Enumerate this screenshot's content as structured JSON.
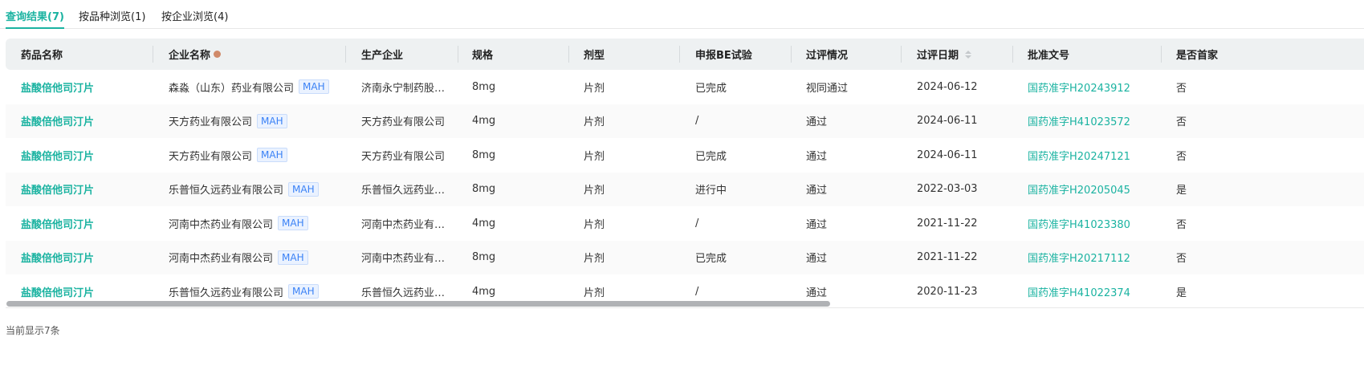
{
  "tabs": [
    {
      "label": "查询结果(7)",
      "active": true
    },
    {
      "label": "按品种浏览(1)"
    },
    {
      "label": "按企业浏览(4)"
    }
  ],
  "columns": [
    "药品名称",
    "企业名称",
    "生产企业",
    "规格",
    "剂型",
    "申报BE试验",
    "过评情况",
    "过评日期",
    "批准文号",
    "是否首家"
  ],
  "tag_label": "MAH",
  "rows": [
    {
      "drug": "盐酸倍他司汀片",
      "company": "森淼（山东）药业有限公司",
      "maker": "济南永宁制药股份…",
      "spec": "8mg",
      "form": "片剂",
      "be": "已完成",
      "status": "视同通过",
      "date": "2024-06-12",
      "approval": "国药准字H20243912",
      "first": "否"
    },
    {
      "drug": "盐酸倍他司汀片",
      "company": "天方药业有限公司",
      "maker": "天方药业有限公司",
      "spec": "4mg",
      "form": "片剂",
      "be": "/",
      "status": "通过",
      "date": "2024-06-11",
      "approval": "国药准字H41023572",
      "first": "否"
    },
    {
      "drug": "盐酸倍他司汀片",
      "company": "天方药业有限公司",
      "maker": "天方药业有限公司",
      "spec": "8mg",
      "form": "片剂",
      "be": "已完成",
      "status": "通过",
      "date": "2024-06-11",
      "approval": "国药准字H20247121",
      "first": "否"
    },
    {
      "drug": "盐酸倍他司汀片",
      "company": "乐普恒久远药业有限公司",
      "maker": "乐普恒久远药业有…",
      "spec": "8mg",
      "form": "片剂",
      "be": "进行中",
      "status": "通过",
      "date": "2022-03-03",
      "approval": "国药准字H20205045",
      "first": "是"
    },
    {
      "drug": "盐酸倍他司汀片",
      "company": "河南中杰药业有限公司",
      "maker": "河南中杰药业有限…",
      "spec": "4mg",
      "form": "片剂",
      "be": "/",
      "status": "通过",
      "date": "2021-11-22",
      "approval": "国药准字H41023380",
      "first": "否"
    },
    {
      "drug": "盐酸倍他司汀片",
      "company": "河南中杰药业有限公司",
      "maker": "河南中杰药业有限…",
      "spec": "8mg",
      "form": "片剂",
      "be": "已完成",
      "status": "通过",
      "date": "2021-11-22",
      "approval": "国药准字H20217112",
      "first": "否"
    },
    {
      "drug": "盐酸倍他司汀片",
      "company": "乐普恒久远药业有限公司",
      "maker": "乐普恒久远药业有…",
      "spec": "4mg",
      "form": "片剂",
      "be": "/",
      "status": "通过",
      "date": "2020-11-23",
      "approval": "国药准字H41022374",
      "first": "是"
    }
  ],
  "footer": "当前显示7条",
  "colors": {
    "accent": "#1bb3a1",
    "tag": "#3b82f6"
  }
}
